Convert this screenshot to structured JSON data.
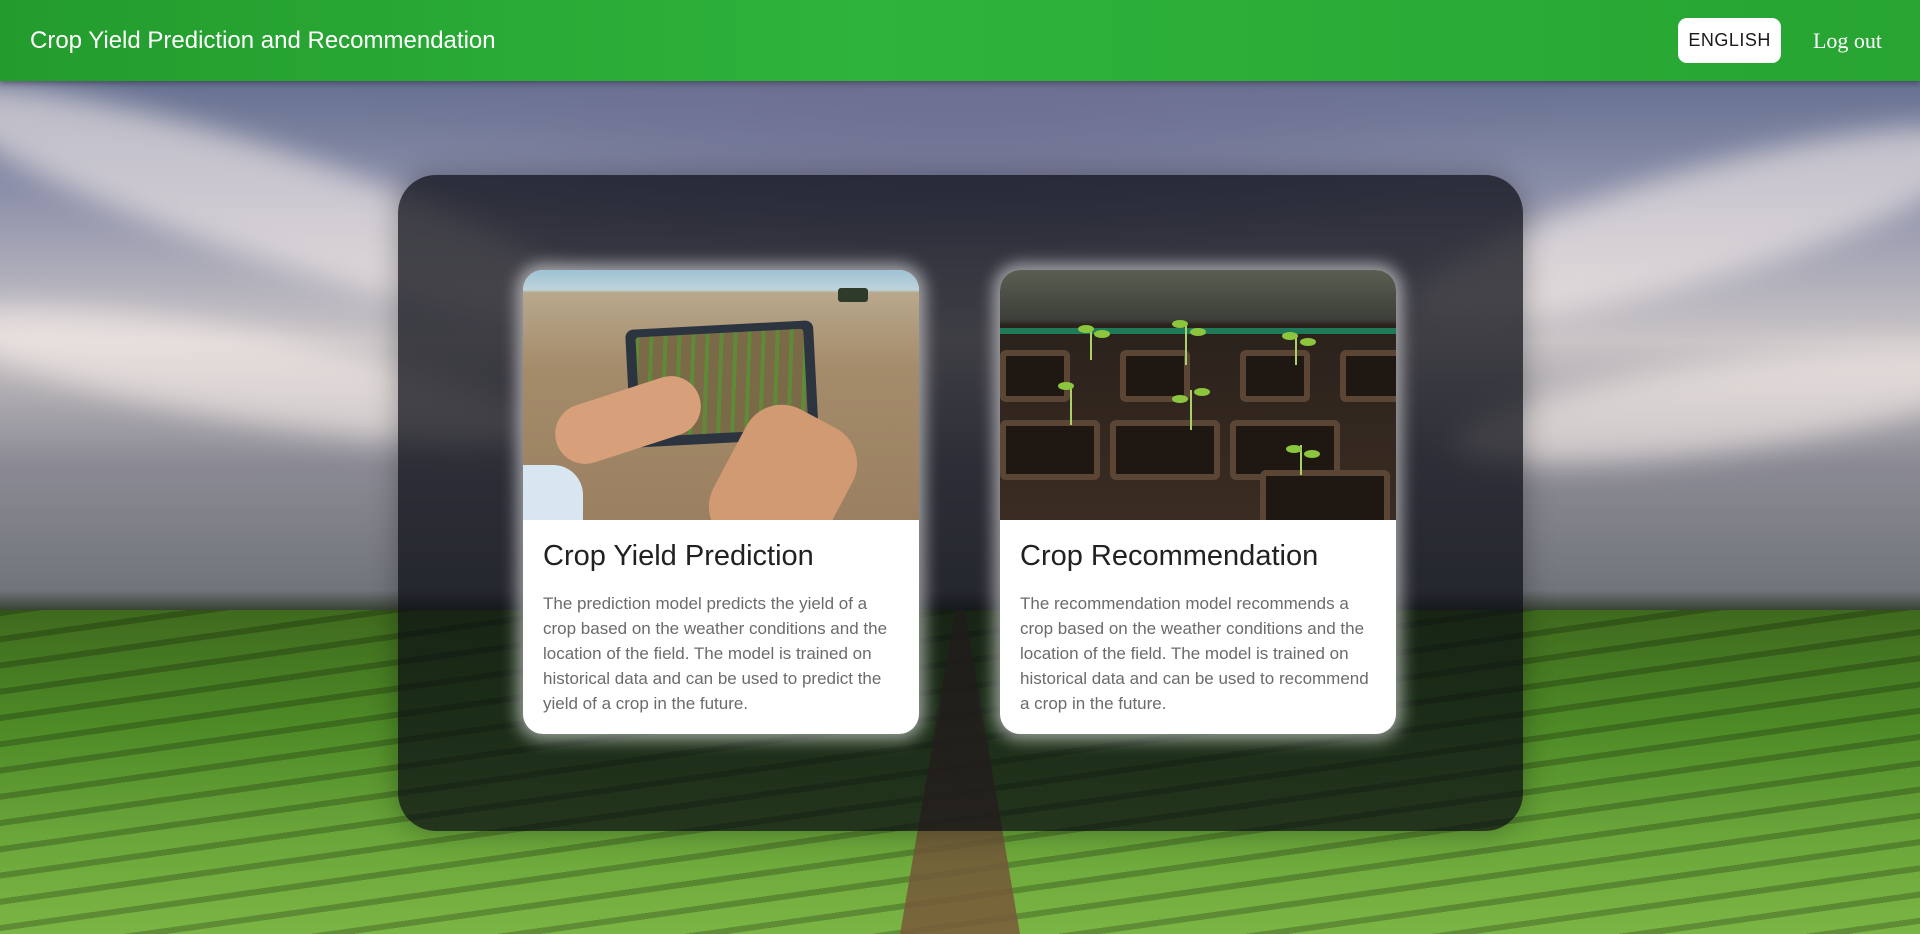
{
  "header": {
    "title": "Crop Yield Prediction and Recommendation",
    "language_button": "ENGLISH",
    "logout_label": "Log out"
  },
  "cards": [
    {
      "title": "Crop Yield Prediction",
      "description": "The prediction model predicts the yield of a crop based on the weather conditions and the location of the field. The model is trained on historical data and can be used to predict the yield of a crop in the future."
    },
    {
      "title": "Crop Recommendation",
      "description": "The recommendation model recommends a crop based on the weather conditions and the location of the field. The model is trained on historical data and can be used to recommend a crop in the future."
    }
  ],
  "colors": {
    "header_green": "#2eb33c",
    "panel_overlay": "#080a12",
    "card_background": "#ffffff"
  }
}
